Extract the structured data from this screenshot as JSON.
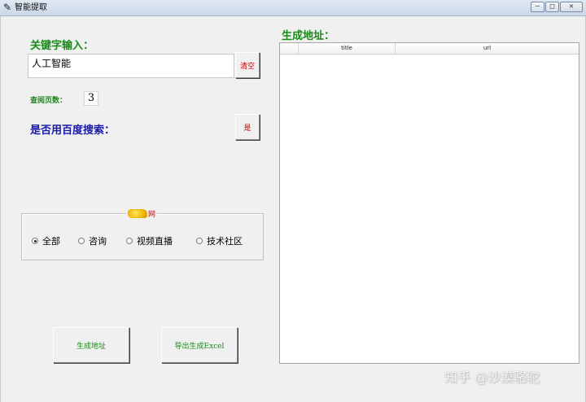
{
  "window": {
    "title": "智能提取",
    "minimize_glyph": "–",
    "maximize_glyph": "□",
    "close_glyph": "✕"
  },
  "keyword": {
    "label": "关键字输入：",
    "value": "人工智能",
    "clear_label": "清空"
  },
  "pages": {
    "label": "查阅页数：",
    "value": "3"
  },
  "baidu": {
    "label": "是否用百度搜索：",
    "button_label": "是"
  },
  "site_group": {
    "title_suffix": "网",
    "options": [
      {
        "label": "全部",
        "selected": true
      },
      {
        "label": "咨询",
        "selected": false
      },
      {
        "label": "视频直播",
        "selected": false
      },
      {
        "label": "技术社区",
        "selected": false
      }
    ]
  },
  "actions": {
    "generate_label": "生成地址",
    "export_label": "导出生成Excel"
  },
  "results": {
    "label": "生成地址：",
    "columns": [
      "title",
      "url"
    ],
    "rows": []
  },
  "watermark": "知乎 @沙漠骆驼",
  "colors": {
    "label_green": "#1a8a1a",
    "label_blue": "#1a1aaa",
    "button_red": "#c00000"
  }
}
